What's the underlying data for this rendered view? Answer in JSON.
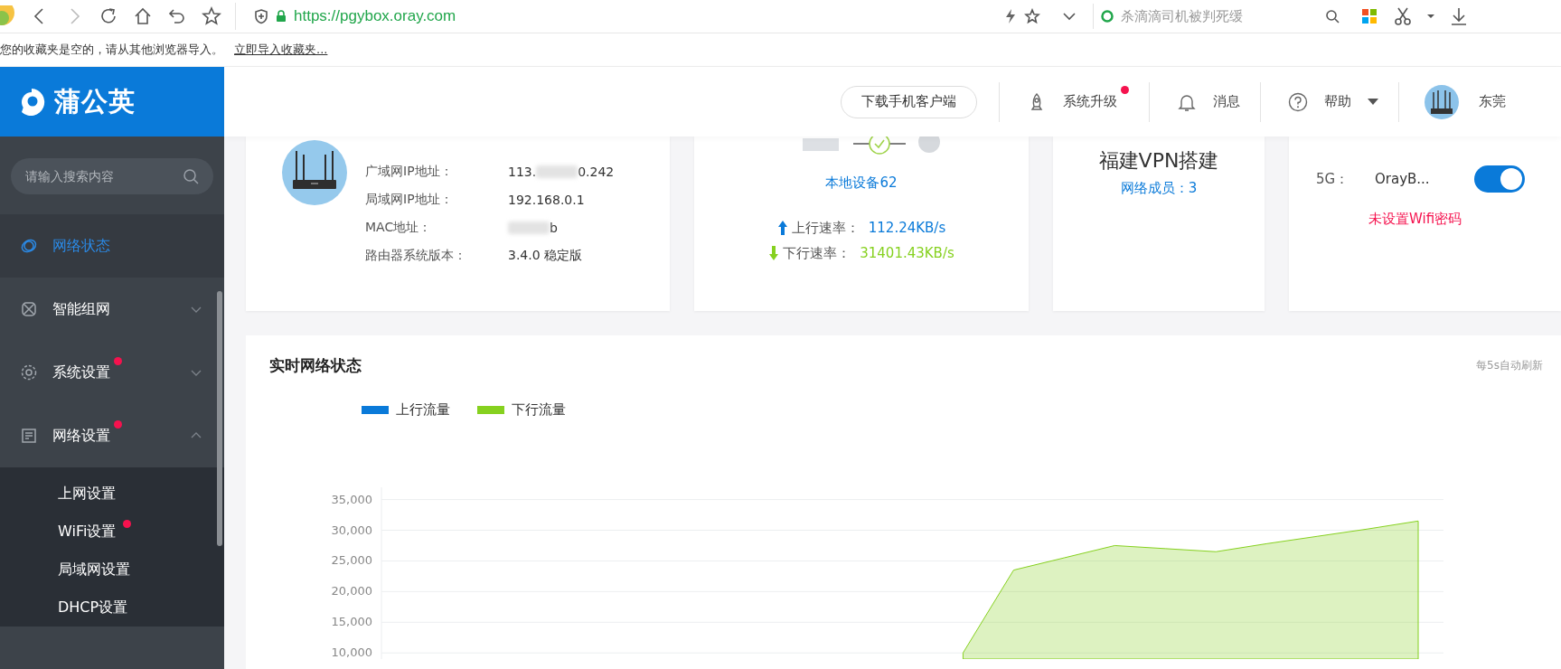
{
  "browser": {
    "url": "https://pgybox.oray.com",
    "search": {
      "placeholder": "杀滴滴司机被判死缓"
    },
    "bookmarks_bar": {
      "message": "您的收藏夹是空的，请从其他浏览器导入。",
      "link": "立即导入收藏夹..."
    }
  },
  "app": {
    "logo": "蒲公英"
  },
  "sidebar": {
    "search": {
      "placeholder": "请输入搜索内容"
    },
    "items": [
      {
        "kind": "link",
        "label": "网络状态",
        "selected": true,
        "dot": false
      },
      {
        "kind": "group",
        "label": "智能组网",
        "selected": false,
        "dot": false,
        "expanded": false
      },
      {
        "kind": "group",
        "label": "系统设置",
        "selected": false,
        "dot": true,
        "expanded": false
      },
      {
        "kind": "group",
        "label": "网络设置",
        "selected": false,
        "dot": true,
        "expanded": true,
        "children": [
          {
            "label": "上网设置",
            "selected": false,
            "dot": false
          },
          {
            "label": "WiFi设置",
            "selected": false,
            "dot": true
          },
          {
            "label": "局域网设置",
            "selected": false,
            "dot": false
          },
          {
            "label": "DHCP设置",
            "selected": false,
            "dot": false
          }
        ]
      }
    ]
  },
  "header": {
    "download_button": "下载手机客户端",
    "actions": [
      {
        "label": "系统升级",
        "dot": true,
        "dropdown": false
      },
      {
        "label": "消息",
        "dot": false,
        "dropdown": false
      },
      {
        "label": "帮助",
        "dot": false,
        "dropdown": true
      }
    ],
    "user": "东莞"
  },
  "router_card": {
    "fields": [
      {
        "label": "广域网IP地址：",
        "value": "113.",
        "redacted": true,
        "value_end": "0.242"
      },
      {
        "label": "局域网IP地址：",
        "value": "192.168.0.1",
        "redacted": false
      },
      {
        "label": "MAC地址：",
        "redacted": true,
        "value_end": "b"
      },
      {
        "label": "路由器系统版本：",
        "value": "3.4.0 稳定版",
        "redacted": false
      }
    ]
  },
  "devices_card": {
    "local_devices": "本地设备62",
    "upload": {
      "label": "上行速率：",
      "value": "112.24KB/s"
    },
    "download": {
      "label": "下行速率：",
      "value": "31401.43KB/s"
    }
  },
  "vpn_card": {
    "title": "福建VPN搭建",
    "members": "网络成员：3"
  },
  "wifi_card": {
    "bands": [
      {
        "label": "5G：",
        "ssid": "OrayB...",
        "on": true
      }
    ],
    "warning": "未设置Wifi密码"
  },
  "traffic_card": {
    "title": "实时网络状态",
    "refresh_note": "每5s自动刷新",
    "chart_data": {
      "type": "area",
      "grid": true,
      "categories": [
        null,
        null,
        null,
        null,
        null,
        null,
        null,
        null,
        null,
        null,
        null,
        null,
        null,
        null,
        null,
        null,
        null,
        null,
        null,
        null,
        null
      ],
      "ylim": [
        9000,
        37000
      ],
      "yticks": [
        {
          "value": 10000,
          "label": "10,000"
        },
        {
          "value": 15000,
          "label": "15,000"
        },
        {
          "value": 20000,
          "label": "20,000"
        },
        {
          "value": 25000,
          "label": "25,000"
        },
        {
          "value": 30000,
          "label": "30,000"
        },
        {
          "value": 35000,
          "label": "35,000"
        }
      ],
      "series": [
        {
          "name": "上行流量",
          "color": "#0a7ad9",
          "values": [
            null,
            null,
            null,
            null,
            null,
            null,
            null,
            null,
            null,
            null,
            null,
            null,
            null,
            null,
            null,
            null,
            null,
            null,
            null,
            null,
            null
          ]
        },
        {
          "name": "下行流量",
          "color": "#86d11f",
          "values": [
            null,
            null,
            null,
            null,
            null,
            null,
            null,
            null,
            null,
            null,
            null,
            10000,
            23500,
            25500,
            27500,
            27000,
            26500,
            27800,
            29000,
            30200,
            31500
          ]
        }
      ]
    }
  }
}
